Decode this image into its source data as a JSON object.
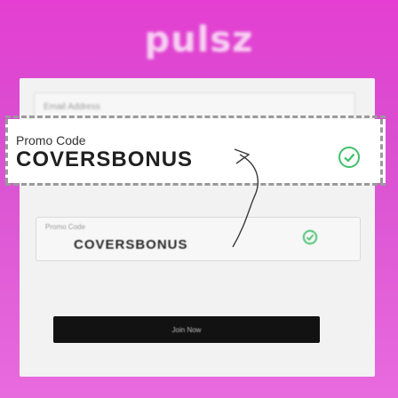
{
  "brand": {
    "logo_text": "pulsz"
  },
  "form": {
    "email_placeholder": "Email Address",
    "promo_field_label": "Promo Code",
    "promo_field_value": "COVERSBONUS",
    "join_button_label": "Join Now"
  },
  "callout": {
    "label": "Promo Code",
    "value": "COVERSBONUS",
    "status_icon": "check-circle-icon"
  },
  "colors": {
    "brand_background": "#e63bd0",
    "check_green": "#3fbf6a",
    "button_dark": "#121212"
  }
}
